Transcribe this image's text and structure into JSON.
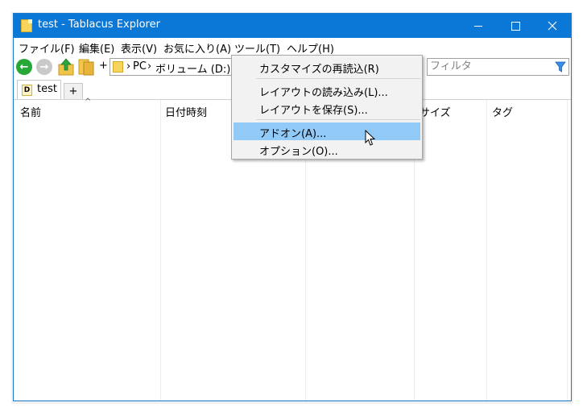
{
  "window": {
    "title": "test - Tablacus Explorer",
    "accent_color": "#0b78d7",
    "controls": [
      "minimize-icon",
      "maximize-icon",
      "close-icon"
    ]
  },
  "menubar": [
    {
      "label": "ファイル(F)"
    },
    {
      "label": "編集(E)"
    },
    {
      "label": "表示(V)"
    },
    {
      "label": "お気に入り(A)"
    },
    {
      "label": "ツール(T)"
    },
    {
      "label": "ヘルプ(H)"
    }
  ],
  "toolbar": {
    "icons": [
      "back-arrow-icon",
      "forward-arrow-icon",
      "up-folder-icon",
      "folder-icon"
    ],
    "plus_label": "+",
    "address": {
      "sep": "›",
      "segments": [
        "PC",
        "ボリューム (D:)"
      ]
    },
    "filter": {
      "placeholder": "フィルタ",
      "icon": "filter-funnel-icon"
    }
  },
  "tabs": {
    "items": [
      {
        "label": "test",
        "icon_letter": "D"
      }
    ],
    "add_label": "+"
  },
  "columns": [
    {
      "label": "名前",
      "sort": "ascending"
    },
    {
      "label": "日付時刻"
    },
    {
      "label": ""
    },
    {
      "label": "サイズ"
    },
    {
      "label": "タグ"
    }
  ],
  "tools_menu": {
    "items": [
      {
        "label": "カスタマイズの再読込(R)"
      },
      {
        "label": "レイアウトの読み込み(L)..."
      },
      {
        "label": "レイアウトを保存(S)..."
      },
      {
        "label": "アドオン(A)...",
        "highlighted": true
      },
      {
        "label": "オプション(O)..."
      }
    ],
    "highlight_color": "#91c9f7"
  }
}
